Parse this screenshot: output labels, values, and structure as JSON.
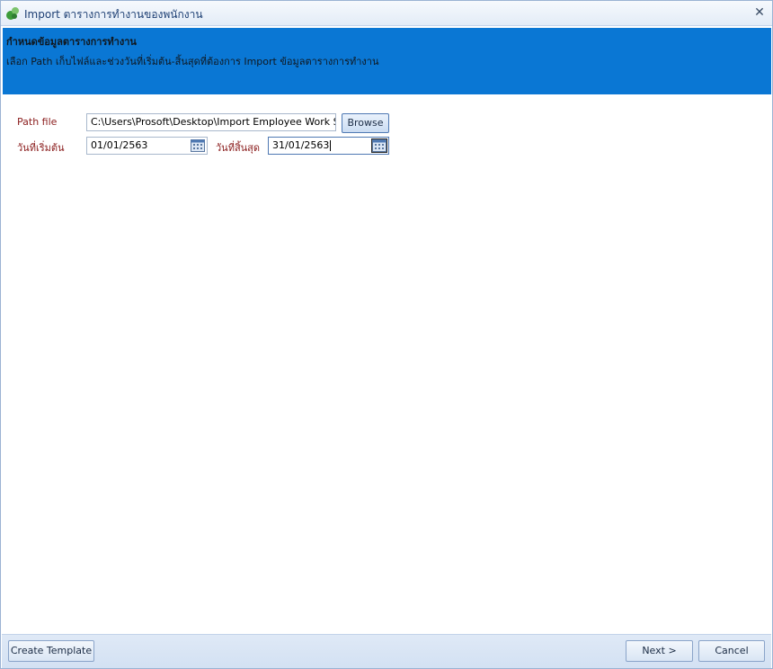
{
  "window": {
    "title": "Import ตารางการทำงานของพนักงาน"
  },
  "banner": {
    "title": "กำหนดข้อมูลตารางการทำงาน",
    "description": "เลือก Path เก็บไฟล์และช่วงวันที่เริ่มต้น-สิ้นสุดที่ต้องการ Import ข้อมูลตารางการทำงาน"
  },
  "form": {
    "path_label": "Path file",
    "path_value": "C:\\Users\\Prosoft\\Desktop\\Import Employee Work Schedu",
    "browse_label": "Browse",
    "start_label": "วันที่เริ่มต้น",
    "start_value": "01/01/2563",
    "end_label": "วันที่สิ้นสุด",
    "end_value": "31/01/2563"
  },
  "footer": {
    "create_template_label": "Create Template",
    "next_label": "Next >",
    "cancel_label": "Cancel"
  },
  "icons": {
    "app": "app-logo-icon",
    "close": "close-icon",
    "calendar": "calendar-icon"
  },
  "colors": {
    "banner": "#0a77d4",
    "label": "#8a1c1c"
  }
}
